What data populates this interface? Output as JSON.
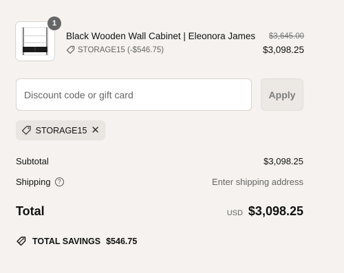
{
  "order": {
    "item": {
      "quantity": "1",
      "title": "Black Wooden Wall Cabinet | Eleonora James",
      "discount_line": "STORAGE15 (-$546.75)",
      "price_original": "$3,645.00",
      "price_final": "$3,098.25"
    }
  },
  "discount": {
    "placeholder": "Discount code or gift card",
    "apply_label": "Apply",
    "applied_code": "STORAGE15",
    "remove_symbol": "✕"
  },
  "summary": {
    "subtotal_label": "Subtotal",
    "subtotal_value": "$3,098.25",
    "shipping_label": "Shipping",
    "shipping_help_symbol": "?",
    "shipping_value": "Enter shipping address",
    "total_label": "Total",
    "currency": "USD",
    "total_value": "$3,098.25",
    "savings_label": "TOTAL SAVINGS",
    "savings_value": "$546.75"
  },
  "colors": {
    "background": "#f5f2ef",
    "badge": "#666666",
    "muted_text": "#666666"
  }
}
